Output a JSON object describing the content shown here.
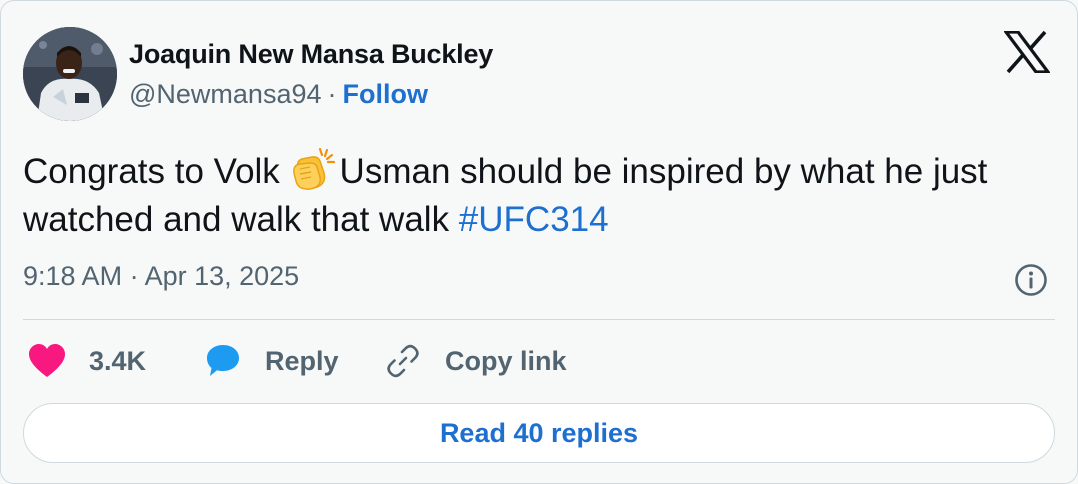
{
  "author": {
    "name": "Joaquin New Mansa Buckley",
    "handle": "@Newmansa94",
    "separator": "·",
    "follow_label": "Follow"
  },
  "tweet": {
    "text_before_emoji": "Congrats to Volk ",
    "emoji": "clapping-hands",
    "text_after_emoji": "Usman should be inspired by what he just watched and walk that walk ",
    "hashtag": "#UFC314",
    "timestamp": "9:18 AM · Apr 13, 2025"
  },
  "actions": {
    "like_count": "3.4K",
    "reply_label": "Reply",
    "copy_link_label": "Copy link"
  },
  "read_replies_label": "Read 40 replies",
  "colors": {
    "link": "#1d6fd0",
    "muted": "#536471",
    "heart": "#f91880",
    "reply_bubble": "#1d9bf0",
    "border": "#cfd9de",
    "background": "#f7f9f9"
  },
  "icons": {
    "platform": "x-logo-icon",
    "info": "info-icon",
    "like": "heart-icon",
    "reply": "reply-bubble-icon",
    "copy": "link-icon"
  }
}
